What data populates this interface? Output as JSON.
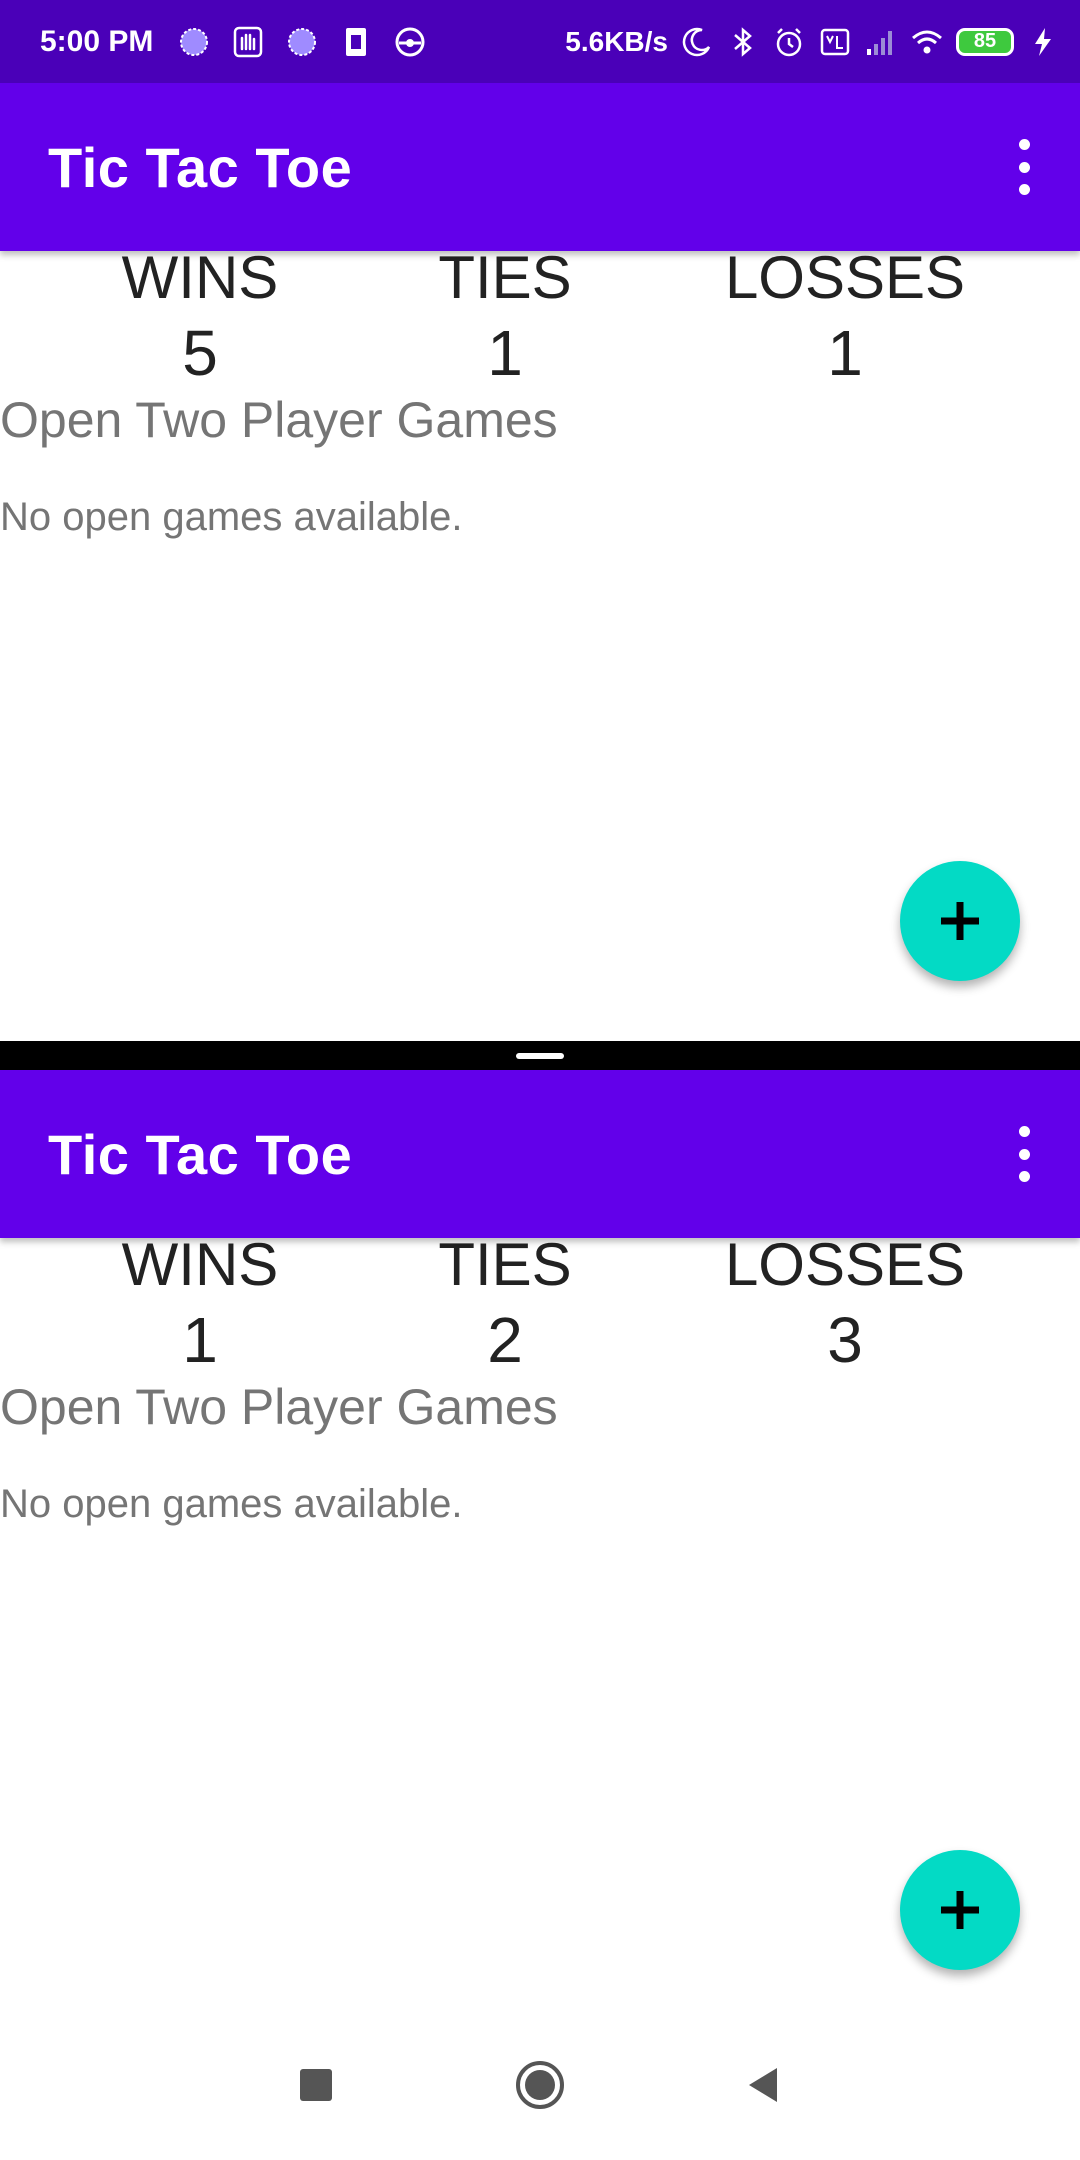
{
  "status_bar": {
    "time": "5:00 PM",
    "speed": "5.6KB/s",
    "battery": "85"
  },
  "panes": [
    {
      "title": "Tic Tac Toe",
      "stats": {
        "wins_label": "WINS",
        "wins": "5",
        "ties_label": "TIES",
        "ties": "1",
        "losses_label": "LOSSES",
        "losses": "1"
      },
      "section_title": "Open Two Player Games",
      "empty_text": "No open games available."
    },
    {
      "title": "Tic Tac Toe",
      "stats": {
        "wins_label": "WINS",
        "wins": "1",
        "ties_label": "TIES",
        "ties": "2",
        "losses_label": "LOSSES",
        "losses": "3"
      },
      "section_title": "Open Two Player Games",
      "empty_text": "No open games available."
    }
  ],
  "colors": {
    "status_bar": "#4a00b8",
    "app_bar": "#6200ea",
    "fab": "#03dac5",
    "secondary_text": "#757575"
  },
  "icons": {
    "overflow": "more-vert-icon",
    "fab": "plus-icon",
    "nav": [
      "recents-square-icon",
      "home-circle-icon",
      "back-triangle-icon"
    ]
  }
}
